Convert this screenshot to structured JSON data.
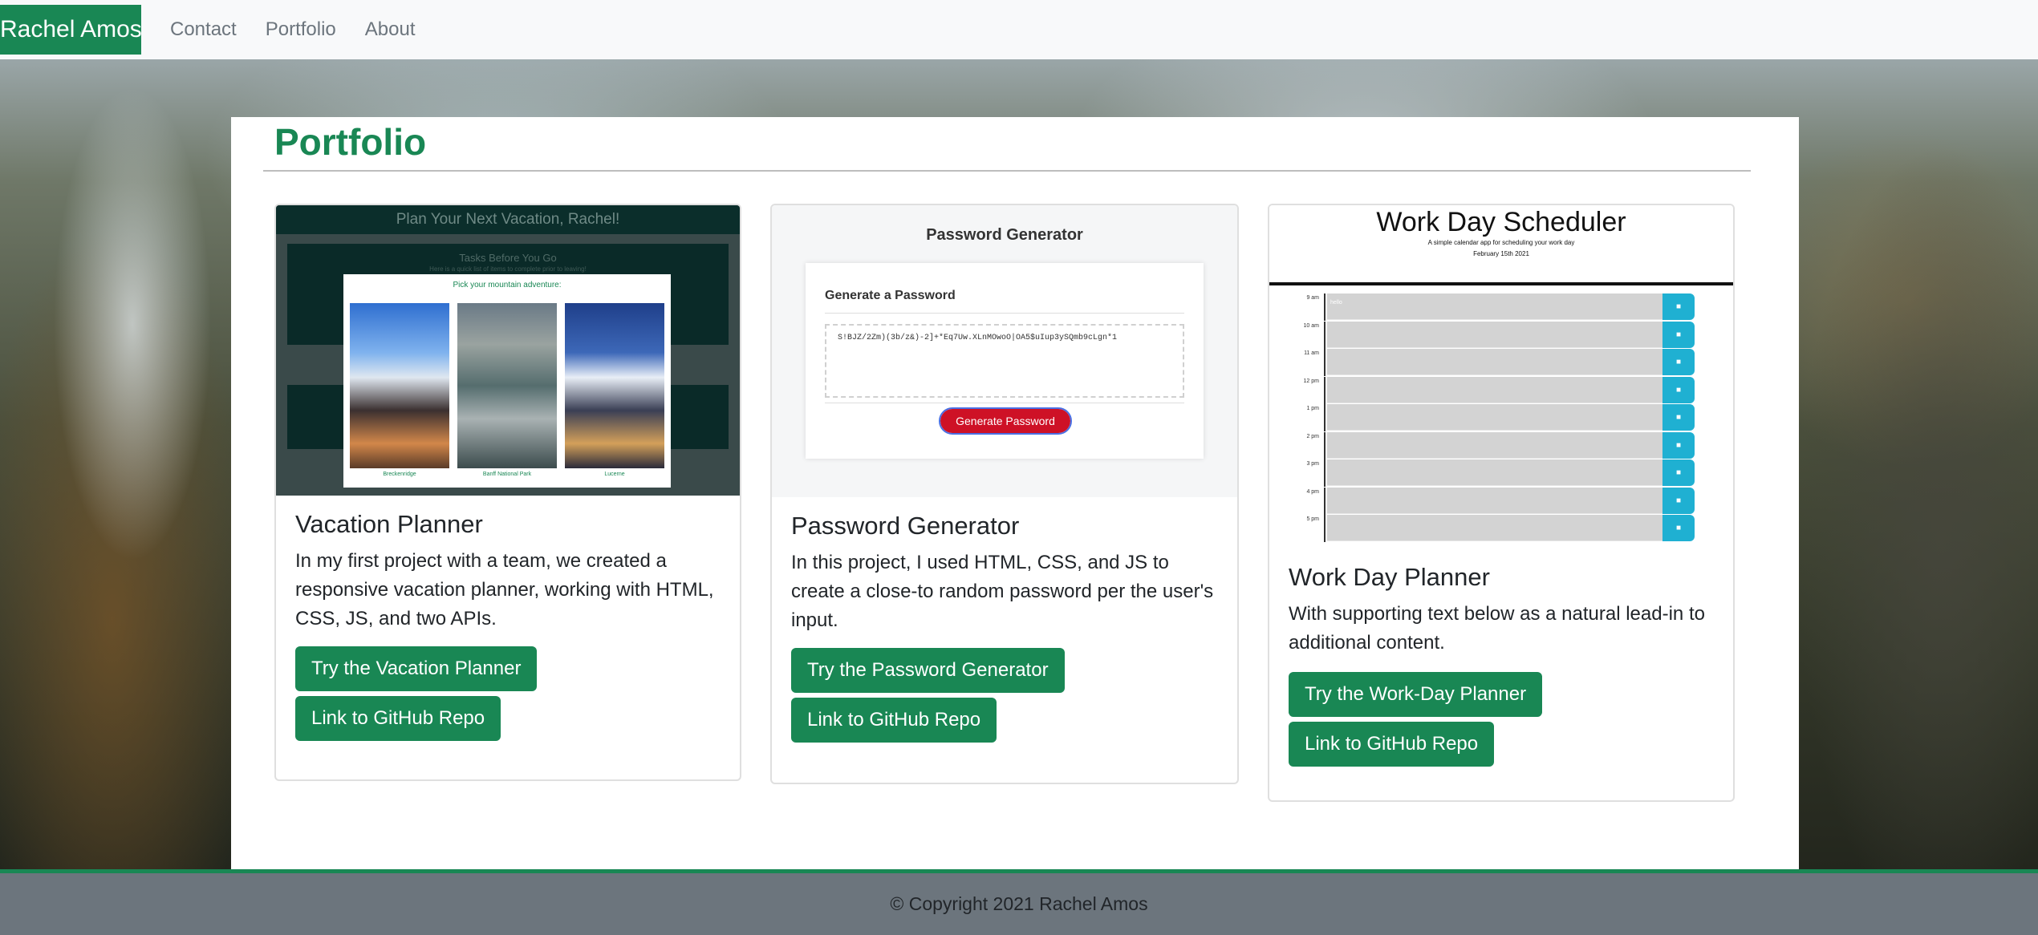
{
  "navbar": {
    "brand": "Rachel Amos",
    "links": [
      "Contact",
      "Portfolio",
      "About"
    ]
  },
  "page": {
    "title": "Portfolio"
  },
  "cards": [
    {
      "title": "Vacation Planner",
      "text": "In my first project with a team, we created a responsive vacation planner, working with HTML, CSS, JS, and two APIs.",
      "primary_button": "Try the Vacation Planner",
      "secondary_button": "Link to GitHub Repo",
      "preview": {
        "heading": "Plan Your Next Vacation, Rachel!",
        "subheading": "Tasks Before You Go",
        "subtext": "Here is a quick list of items to complete prior to leaving!",
        "modal_title": "Pick your mountain adventure:",
        "captions": [
          "Breckenridge",
          "Banff National Park",
          "Lucerne"
        ]
      }
    },
    {
      "title": "Password Generator",
      "text": "In this project, I used HTML, CSS, and JS to create a close-to random password per the user's input.",
      "primary_button": "Try the Password Generator",
      "secondary_button": "Link to GitHub Repo",
      "preview": {
        "heading": "Password Generator",
        "box_title": "Generate a Password",
        "password": "S!BJZ/2Zm)(3b/z&)-2]+*Eq7Uw.XLnMOwoO|OA5$uIup3ySQmb9cLgn*1",
        "button": "Generate Password"
      }
    },
    {
      "title": "Work Day Planner",
      "text": "With supporting text below as a natural lead-in to additional content.",
      "primary_button": "Try the Work-Day Planner",
      "secondary_button": "Link to GitHub Repo",
      "preview": {
        "heading": "Work Day Scheduler",
        "subheading": "A simple calendar app for scheduling your work day",
        "date": "February 15th 2021",
        "first_slot_text": "hello",
        "hours": [
          "9 am",
          "10 am",
          "11 am",
          "12 pm",
          "1 pm",
          "2 pm",
          "3 pm",
          "4 pm",
          "5 pm"
        ]
      }
    }
  ],
  "footer": {
    "text": "© Copyright 2021 Rachel Amos"
  },
  "colors": {
    "brand_green": "#198754",
    "navbar_bg": "#f8f9fa",
    "footer_bg": "#6c757d"
  }
}
